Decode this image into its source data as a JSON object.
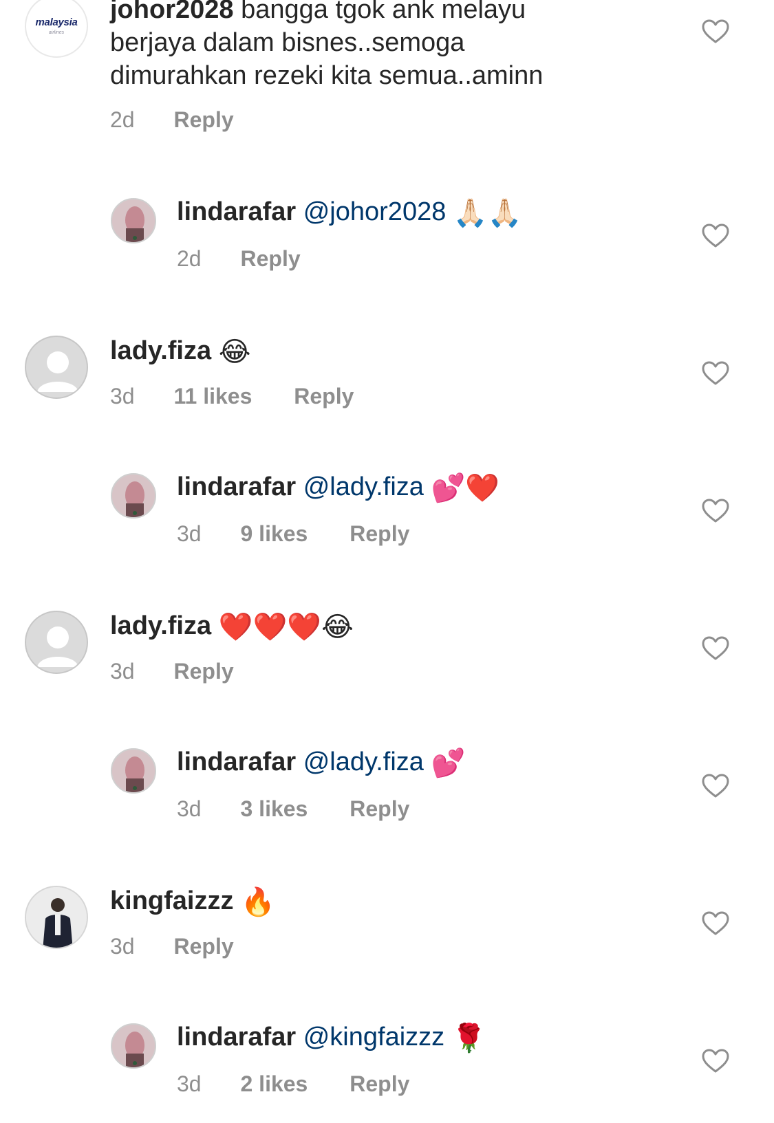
{
  "comments": [
    {
      "username": "johor2028",
      "text": "bangga tgok ank melayu",
      "text_line2": "berjaya dalam bisnes..semoga",
      "text_line3": "dimurahkan rezeki kita semua..aminn",
      "time": "2d",
      "reply_label": "Reply",
      "avatar": "malaysia-airlines-logo",
      "avatar_text": "malaysia",
      "avatar_subtext": "airlines"
    },
    {
      "username": "lindarafar",
      "mention": "@johor2028",
      "emoji": "🙏🏻🙏🏻",
      "time": "2d",
      "reply_label": "Reply"
    },
    {
      "username": "lady.fiza",
      "emoji": "😂",
      "time": "3d",
      "likes": "11 likes",
      "reply_label": "Reply"
    },
    {
      "username": "lindarafar",
      "mention": "@lady.fiza",
      "emoji": "💕❤️",
      "time": "3d",
      "likes": "9 likes",
      "reply_label": "Reply"
    },
    {
      "username": "lady.fiza",
      "emoji": "❤️❤️❤️😂",
      "time": "3d",
      "reply_label": "Reply"
    },
    {
      "username": "lindarafar",
      "mention": "@lady.fiza",
      "emoji": "💕",
      "time": "3d",
      "likes": "3 likes",
      "reply_label": "Reply"
    },
    {
      "username": "kingfaizzz",
      "emoji": "🔥",
      "time": "3d",
      "reply_label": "Reply"
    },
    {
      "username": "lindarafar",
      "mention": "@kingfaizzz",
      "emoji": "🌹",
      "time": "3d",
      "likes": "2 likes",
      "reply_label": "Reply"
    }
  ],
  "colors": {
    "text": "#262626",
    "muted": "#8e8e8e",
    "mention": "#00376b",
    "heart_outline": "#8e8e8e"
  },
  "icons": {
    "like": "heart-outline-icon",
    "placeholder_avatar": "default-user-icon"
  }
}
